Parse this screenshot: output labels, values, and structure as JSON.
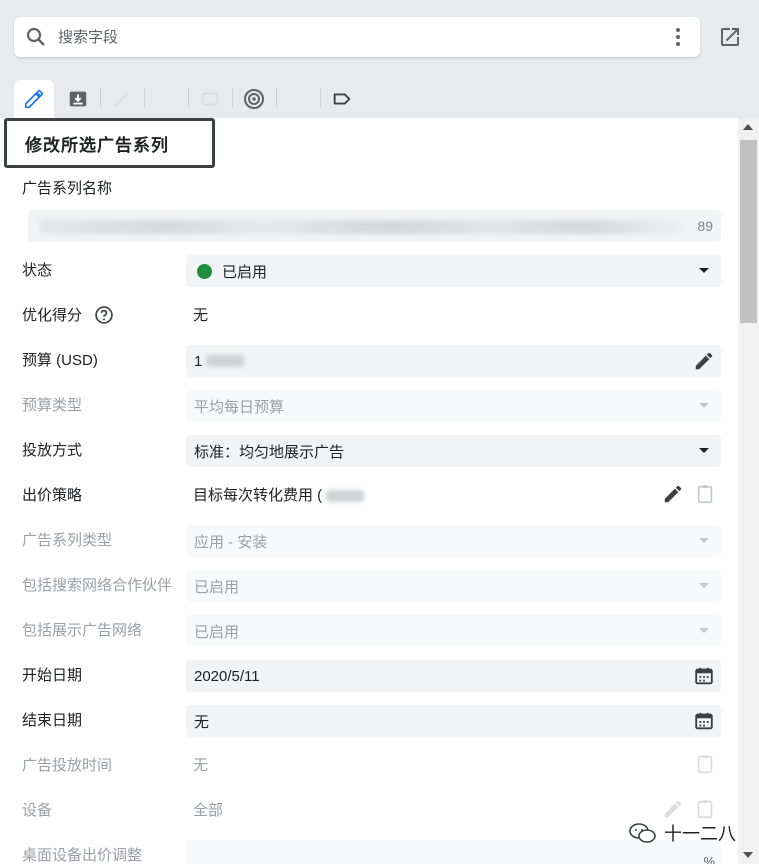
{
  "search": {
    "placeholder": "搜索字段",
    "value": ""
  },
  "tabs": [
    {
      "name": "edit",
      "icon": "pencil-icon",
      "active": true
    },
    {
      "name": "download",
      "icon": "download-icon",
      "active": false
    },
    {
      "name": "draw",
      "icon": "line-icon",
      "active": false,
      "disabled": true
    },
    {
      "name": "image",
      "icon": "image-icon",
      "active": false,
      "disabled": true
    },
    {
      "name": "video",
      "icon": "video-icon",
      "active": false,
      "disabled": true
    },
    {
      "name": "target",
      "icon": "target-icon",
      "active": false
    },
    {
      "name": "link",
      "icon": "link-icon",
      "active": false,
      "disabled": true
    },
    {
      "name": "label",
      "icon": "label-icon",
      "active": false
    }
  ],
  "panel": {
    "title": "修改所选广告系列",
    "name_field": {
      "label": "广告系列名称",
      "char_count": "89"
    },
    "rows": [
      {
        "label": "状态",
        "value": "已启用"
      },
      {
        "label": "优化得分",
        "value": "无"
      },
      {
        "label": "预算 (USD)",
        "value": "1"
      },
      {
        "label": "预算类型",
        "value": "平均每日预算"
      },
      {
        "label": "投放方式",
        "value": "标准：均匀地展示广告"
      },
      {
        "label": "出价策略",
        "value": "目标每次转化费用 ("
      },
      {
        "label": "广告系列类型",
        "value": "应用 - 安装"
      },
      {
        "label": "包括搜索网络合作伙伴",
        "value": "已启用"
      },
      {
        "label": "包括展示广告网络",
        "value": "已启用"
      },
      {
        "label": "开始日期",
        "value": "2020/5/11"
      },
      {
        "label": "结束日期",
        "value": "无"
      },
      {
        "label": "广告投放时间",
        "value": "无"
      },
      {
        "label": "设备",
        "value": "全部"
      },
      {
        "label": "桌面设备出价调整",
        "value": "",
        "suffix": "%"
      }
    ]
  },
  "watermark": {
    "text": "十一二八"
  },
  "colors": {
    "status_enabled": "#1e8e3e",
    "accent": "#1a73e8"
  }
}
